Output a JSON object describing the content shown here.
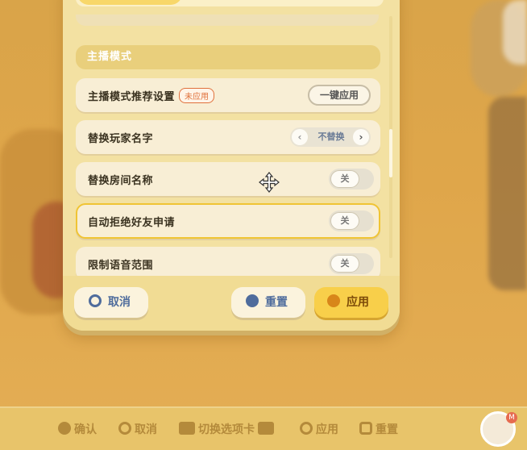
{
  "section": {
    "title": "主播模式"
  },
  "rows": [
    {
      "label": "主播模式推荐设置",
      "badge": "未应用",
      "button": "一键应用"
    },
    {
      "label": "替换玩家名字",
      "value": "不替换"
    },
    {
      "label": "替换房间名称",
      "toggle": "关"
    },
    {
      "label": "自动拒绝好友申请",
      "toggle": "关"
    },
    {
      "label": "限制语音范围",
      "toggle": "关"
    }
  ],
  "footer": {
    "cancel": "取消",
    "reset": "重置",
    "apply": "应用"
  },
  "hints": [
    {
      "icon": "x-button-icon",
      "label": "确认"
    },
    {
      "icon": "circle-button-icon",
      "label": "取消"
    },
    {
      "icon": "shoulder-buttons-icon",
      "label": "切换选项卡"
    },
    {
      "icon": "triangle-button-icon",
      "label": "应用"
    },
    {
      "icon": "square-button-icon",
      "label": "重置"
    }
  ],
  "avatar": {
    "badge": "M"
  }
}
